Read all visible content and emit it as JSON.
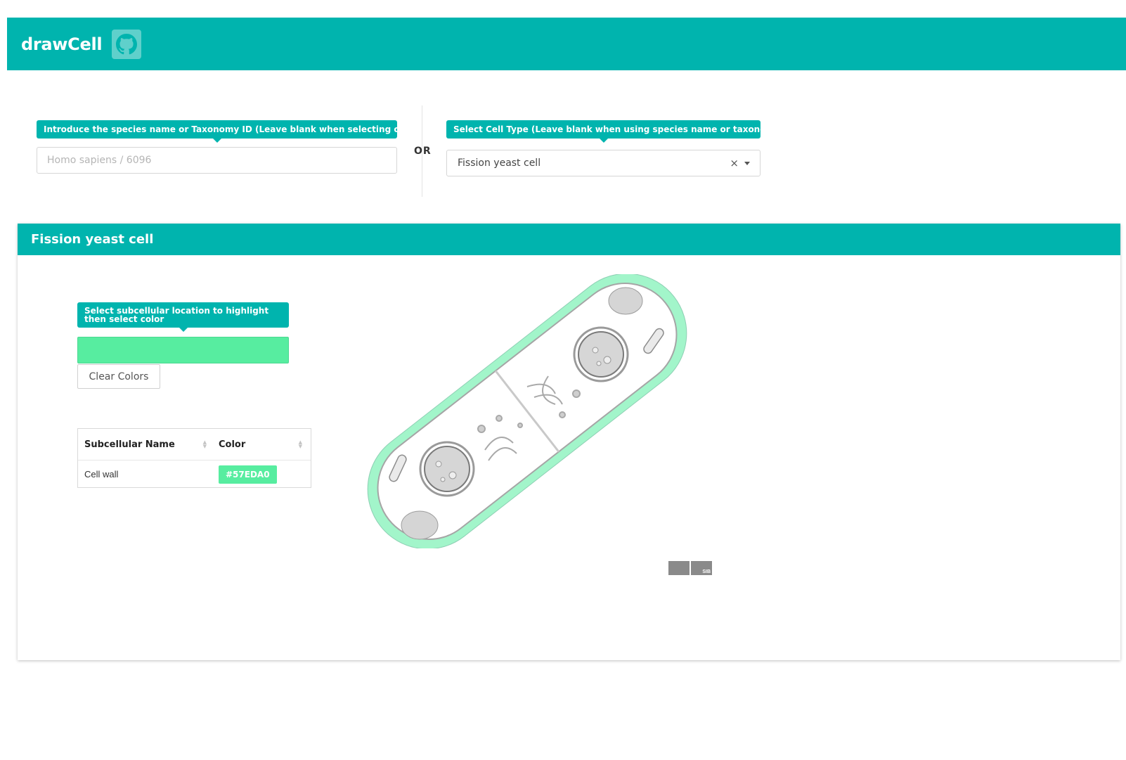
{
  "app": {
    "title": "drawCell",
    "github_icon": "github-icon"
  },
  "species": {
    "tooltip": "Introduce the species name or Taxonomy ID (Leave blank when selecting cell type)",
    "placeholder": "Homo sapiens / 6096",
    "value": ""
  },
  "separator": {
    "label": "OR"
  },
  "cell_type": {
    "tooltip": "Select Cell Type (Leave blank when using species name or taxonomy ID)",
    "value": "Fission yeast cell",
    "clear": "×"
  },
  "panel": {
    "title": "Fission yeast cell",
    "tooltip": "Select subcellular location to highlight then select color",
    "selected_color": "#57EDA0",
    "clear_button": "Clear Colors",
    "table": {
      "headers": [
        "Subcellular Name",
        "Color"
      ],
      "rows": [
        {
          "name": "Cell wall",
          "color": "#57EDA0"
        }
      ]
    },
    "logos": [
      "expasy-logo",
      "sib-logo"
    ],
    "logo_text": "SIB"
  },
  "colors": {
    "brand": "#00B4AE",
    "highlight": "#57EDA0"
  }
}
